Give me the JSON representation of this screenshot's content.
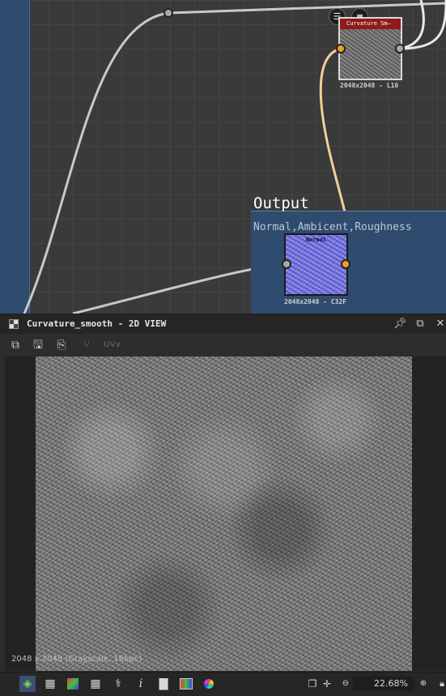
{
  "graph": {
    "output_frame": {
      "title": "Output",
      "subtitle": "Normal,Ambicent,Roughness"
    },
    "curvature_node": {
      "header": "Curvature Sm—",
      "resolution": "2048x2048 - L16"
    },
    "normal_node": {
      "header": "Normal",
      "resolution": "2048x2048 - C32F"
    },
    "badges": [
      "document-icon",
      "checker-icon"
    ]
  },
  "panel": {
    "title": "Curvature_smooth - 2D VIEW",
    "status": "2048 x 2048 (Grayscale, 16bpc)",
    "toolbar": {
      "uv_label": "UV"
    },
    "bottom": {
      "zoom": "22.68%",
      "info_glyph": "i"
    }
  },
  "colors": {
    "frame_blue": "#2f4b6e",
    "wire_orange": "#f0a020",
    "wire_grey": "#c8c8c8",
    "node_header_red": "#8e1a1a"
  }
}
